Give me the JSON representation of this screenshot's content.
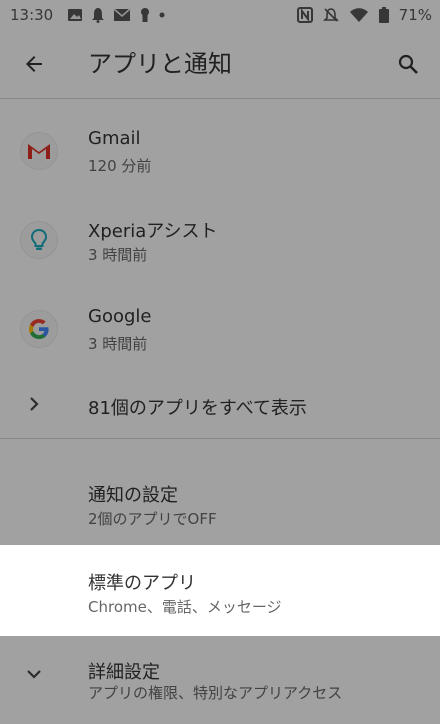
{
  "status_bar": {
    "time": "13:30",
    "battery": "71%"
  },
  "app_bar": {
    "title": "アプリと通知"
  },
  "recent_apps": [
    {
      "name": "Gmail",
      "subtitle": "120 分前",
      "icon": "gmail-icon"
    },
    {
      "name": "Xperiaアシスト",
      "subtitle": "3 時間前",
      "icon": "lightbulb-icon"
    },
    {
      "name": "Google",
      "subtitle": "3 時間前",
      "icon": "google-icon"
    }
  ],
  "see_all": {
    "label": "81個のアプリをすべて表示"
  },
  "settings": {
    "notifications": {
      "title": "通知の設定",
      "subtitle": "2個のアプリでOFF"
    },
    "default_apps": {
      "title": "標準のアプリ",
      "subtitle": "Chrome、電話、メッセージ"
    },
    "advanced": {
      "title": "詳細設定",
      "subtitle": "アプリの権限、特別なアプリアクセス"
    }
  },
  "colors": {
    "gmail_red": "#d93025",
    "google_blue": "#4285f4",
    "google_red": "#ea4335",
    "google_yellow": "#fbbc05",
    "google_green": "#34a853",
    "xperia_teal": "#1aa7b8"
  }
}
